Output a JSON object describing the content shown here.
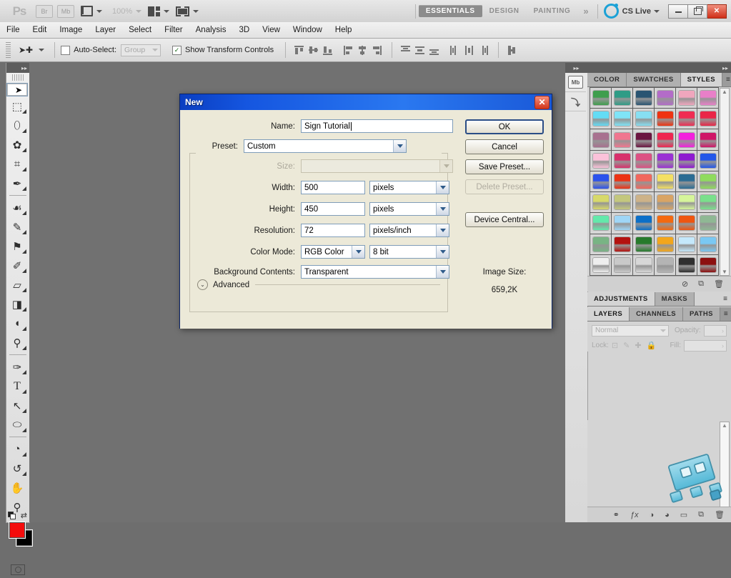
{
  "app": {
    "name": "Adobe Photoshop",
    "logo_text": "Ps",
    "zoom_level": "100%",
    "bridge_label": "Br",
    "minibridge_label": "Mb"
  },
  "appbar": {
    "workspaces": [
      {
        "label": "ESSENTIALS",
        "active": true
      },
      {
        "label": "DESIGN",
        "active": false
      },
      {
        "label": "PAINTING",
        "active": false
      }
    ],
    "more_chevrons": "»",
    "cs_live_label": "CS Live",
    "window_buttons": [
      "minimize",
      "restore",
      "close"
    ],
    "close_glyph": "✕"
  },
  "menubar": {
    "items": [
      "File",
      "Edit",
      "Image",
      "Layer",
      "Select",
      "Filter",
      "Analysis",
      "3D",
      "View",
      "Window",
      "Help"
    ]
  },
  "options_bar": {
    "auto_select_label": "Auto-Select:",
    "auto_select_checked": false,
    "auto_select_scope": "Group",
    "show_transform_label": "Show Transform Controls",
    "show_transform_checked": true,
    "check_glyph": "✓",
    "align_group_1": [
      "align-top-edges",
      "align-vertical-centers",
      "align-bottom-edges"
    ],
    "align_group_2": [
      "align-left-edges",
      "align-horizontal-centers",
      "align-right-edges"
    ],
    "distribute_group_1": [
      "distribute-top-edges",
      "distribute-vertical-centers",
      "distribute-bottom-edges"
    ],
    "distribute_group_2": [
      "distribute-left-edges",
      "distribute-horizontal-centers",
      "distribute-right-edges"
    ],
    "auto_align_label": "auto-align-layers"
  },
  "toolbar": {
    "tools": [
      {
        "name": "move-tool",
        "glyph": "➤",
        "selected": true,
        "corner": false
      },
      {
        "name": "rectangular-marquee-tool",
        "glyph": "⬚",
        "selected": false,
        "corner": true
      },
      {
        "name": "lasso-tool",
        "glyph": "⬯",
        "selected": false,
        "corner": true
      },
      {
        "name": "quick-selection-tool",
        "glyph": "✿",
        "selected": false,
        "corner": true
      },
      {
        "name": "crop-tool",
        "glyph": "⌗",
        "selected": false,
        "corner": true
      },
      {
        "name": "eyedropper-tool",
        "glyph": "✒",
        "selected": false,
        "corner": true
      },
      {
        "name": "spot-healing-brush-tool",
        "glyph": "☙",
        "selected": false,
        "corner": true
      },
      {
        "name": "brush-tool",
        "glyph": "✎",
        "selected": false,
        "corner": true
      },
      {
        "name": "clone-stamp-tool",
        "glyph": "⚑",
        "selected": false,
        "corner": true
      },
      {
        "name": "history-brush-tool",
        "glyph": "✐",
        "selected": false,
        "corner": true
      },
      {
        "name": "eraser-tool",
        "glyph": "▱",
        "selected": false,
        "corner": true
      },
      {
        "name": "gradient-tool",
        "glyph": "◨",
        "selected": false,
        "corner": true
      },
      {
        "name": "blur-tool",
        "glyph": "◖",
        "selected": false,
        "corner": true
      },
      {
        "name": "dodge-tool",
        "glyph": "⚲",
        "selected": false,
        "corner": true
      },
      {
        "name": "pen-tool",
        "glyph": "✑",
        "selected": false,
        "corner": true
      },
      {
        "name": "horizontal-type-tool",
        "glyph": "T",
        "selected": false,
        "corner": true
      },
      {
        "name": "path-selection-tool",
        "glyph": "↖",
        "selected": false,
        "corner": true
      },
      {
        "name": "ellipse-tool",
        "glyph": "⬭",
        "selected": false,
        "corner": true
      },
      {
        "name": "3d-object-rotate-tool",
        "glyph": "◔",
        "selected": false,
        "corner": true
      },
      {
        "name": "3d-rotate-camera-tool",
        "glyph": "↺",
        "selected": false,
        "corner": true
      },
      {
        "name": "hand-tool",
        "glyph": "✋",
        "selected": false,
        "corner": true
      },
      {
        "name": "zoom-tool",
        "glyph": "⚲",
        "selected": false,
        "corner": true
      }
    ],
    "foreground_color": "#f40c0c",
    "background_color": "#000000",
    "swap_glyph": "⇄",
    "quick_mask_label": "edit-in-quick-mask-mode"
  },
  "dock": {
    "collapse_glyph": "▸▸",
    "icon_buttons": [
      {
        "name": "mini-bridge-icon",
        "label": "Mb"
      },
      {
        "name": "history-icon",
        "label": "⤵"
      }
    ],
    "styles_panel": {
      "tabs": [
        {
          "label": "COLOR",
          "active": false
        },
        {
          "label": "SWATCHES",
          "active": false
        },
        {
          "label": "STYLES",
          "active": true
        }
      ],
      "menu_glyph": "≡",
      "swatch_rows": [
        [
          "#3f9e4d",
          "#2f9c86",
          "#2a5472",
          "#b36cc8",
          "#f0a6bd",
          "#e87fc8"
        ],
        [
          "#63dcf5",
          "#7fe4f7",
          "#87dff2",
          "#ef3311",
          "#f02b52",
          "#ea2547"
        ],
        [
          "#a8718f",
          "#f0768f",
          "#6b1540",
          "#ef2550",
          "#f321dd",
          "#cf1667"
        ],
        [
          "#fbc2da",
          "#d8306b",
          "#dc5183",
          "#9a31d4",
          "#8e1ad0",
          "#2357e8"
        ],
        [
          "#2b52ec",
          "#ec3214",
          "#f1675d",
          "#f4e063",
          "#2b6c93",
          "#8fdb5d"
        ],
        [
          "#d7d96a",
          "#c3c77d",
          "#cdb288",
          "#d9a464",
          "#d6f59a",
          "#79e08b"
        ],
        [
          "#63e9ab",
          "#9fd6f7",
          "#0b6fc8",
          "#f4690f",
          "#ef5510",
          "#8fb894"
        ],
        [
          "#78b484",
          "#b4120f",
          "#267a2b",
          "#f3a61b",
          "#c4e8fb",
          "#7ac8f3"
        ],
        [
          "#eeeeee",
          "#c9c9c9",
          "#d7d7d7",
          "#b4b4b4",
          "#2f2f2f",
          "#8c1010"
        ]
      ],
      "footer_icons": [
        {
          "name": "clear-style-icon",
          "glyph": "⊘"
        },
        {
          "name": "new-style-icon",
          "glyph": "⧉"
        },
        {
          "name": "delete-style-icon",
          "glyph": "🗑"
        }
      ],
      "scroll_up_glyph": "▲",
      "scroll_down_glyph": "▼"
    },
    "adjustments_panel": {
      "tabs": [
        {
          "label": "ADJUSTMENTS",
          "active": true
        },
        {
          "label": "MASKS",
          "active": false
        }
      ],
      "menu_glyph": "≡"
    },
    "layers_panel": {
      "tabs": [
        {
          "label": "LAYERS",
          "active": true
        },
        {
          "label": "CHANNELS",
          "active": false
        },
        {
          "label": "PATHS",
          "active": false
        }
      ],
      "menu_glyph": "≡",
      "blend_mode": "Normal",
      "opacity_label": "Opacity:",
      "opacity_value": "",
      "lock_label": "Lock:",
      "fill_label": "Fill:",
      "fill_value": "",
      "lock_icons": [
        {
          "name": "lock-transparent-pixels-icon",
          "glyph": "⊡"
        },
        {
          "name": "lock-image-pixels-icon",
          "glyph": "✎"
        },
        {
          "name": "lock-position-icon",
          "glyph": "✚"
        },
        {
          "name": "lock-all-icon",
          "glyph": "🔒"
        }
      ],
      "footer_icons": [
        {
          "name": "link-layers-icon",
          "glyph": "⚭"
        },
        {
          "name": "layer-style-icon",
          "glyph": "ƒx"
        },
        {
          "name": "layer-mask-icon",
          "glyph": "◑"
        },
        {
          "name": "adjustment-layer-icon",
          "glyph": "◕"
        },
        {
          "name": "new-group-icon",
          "glyph": "▭"
        },
        {
          "name": "new-layer-icon",
          "glyph": "⧉"
        },
        {
          "name": "delete-layer-icon",
          "glyph": "🗑"
        }
      ],
      "scroll_up_glyph": "▲",
      "scroll_down_glyph": "▼"
    }
  },
  "new_dialog": {
    "title": "New",
    "close_glyph": "✕",
    "name_label": "Name:",
    "name_value": "Sign Tutorial",
    "preset_label": "Preset:",
    "preset_value": "Custom",
    "size_label": "Size:",
    "size_value": "",
    "size_disabled": true,
    "width_label": "Width:",
    "width_value": "500",
    "width_unit": "pixels",
    "height_label": "Height:",
    "height_value": "450",
    "height_unit": "pixels",
    "resolution_label": "Resolution:",
    "resolution_value": "72",
    "resolution_unit": "pixels/inch",
    "color_mode_label": "Color Mode:",
    "color_mode_value": "RGB Color",
    "color_depth_value": "8 bit",
    "background_contents_label": "Background Contents:",
    "background_contents_value": "Transparent",
    "advanced_label": "Advanced",
    "advanced_glyph": "⌄",
    "image_size_label": "Image Size:",
    "image_size_value": "659,2K",
    "buttons": [
      {
        "name": "ok-button",
        "label": "OK",
        "default": true,
        "disabled": false
      },
      {
        "name": "cancel-button",
        "label": "Cancel",
        "default": false,
        "disabled": false
      },
      {
        "name": "save-preset-button",
        "label": "Save Preset...",
        "default": false,
        "disabled": false
      },
      {
        "name": "delete-preset-button",
        "label": "Delete Preset...",
        "default": false,
        "disabled": true
      },
      {
        "name": "device-central-button",
        "label": "Device Central...",
        "default": false,
        "disabled": false
      }
    ]
  }
}
